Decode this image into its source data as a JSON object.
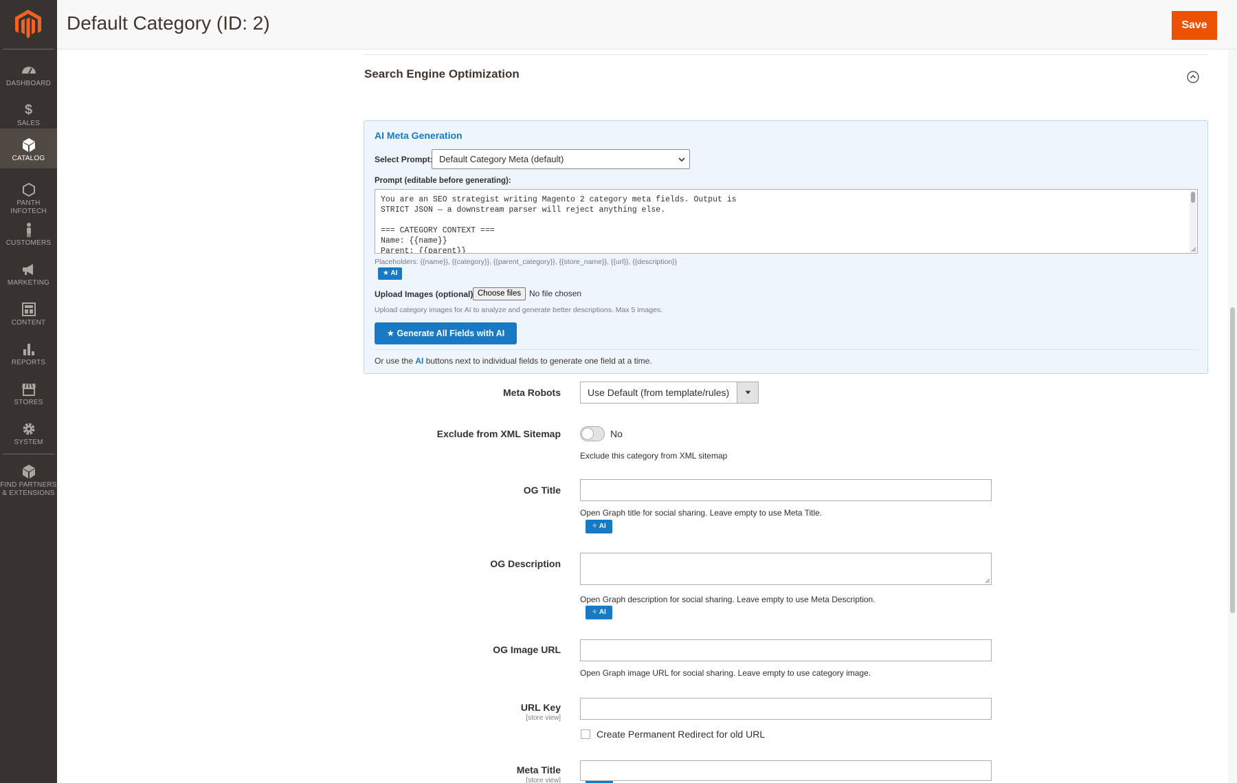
{
  "sidebar": {
    "items": [
      {
        "label": "DASHBOARD",
        "icon": "dashboard-icon"
      },
      {
        "label": "$",
        "icon": "dollar-icon"
      },
      {
        "label": "SALES",
        "icon": "sales-icon"
      },
      {
        "label": "CATALOG",
        "icon": "box-icon"
      },
      {
        "label": "PANTH\nINFOTECH",
        "icon": "hexagon-icon"
      },
      {
        "label": "CUSTOMERS",
        "icon": "person-icon"
      },
      {
        "label": "MARKETING",
        "icon": "megaphone-icon"
      },
      {
        "label": "CONTENT",
        "icon": "layout-icon"
      },
      {
        "label": "REPORTS",
        "icon": "bar-chart-icon"
      },
      {
        "label": "STORES",
        "icon": "store-icon"
      },
      {
        "label": "SYSTEM",
        "icon": "gear-icon"
      },
      {
        "label": "FIND PARTNERS\n& EXTENSIONS",
        "icon": "cube-icon"
      }
    ],
    "active": "CATALOG"
  },
  "header": {
    "title": "Default Category (ID: 2)",
    "save_label": "Save"
  },
  "section": {
    "title": "Search Engine Optimization"
  },
  "ai_panel": {
    "title": "AI Meta Generation",
    "select_prompt_label": "Select Prompt:",
    "select_prompt_value": "Default Category Meta (default)",
    "prompt_label": "Prompt (editable before generating):",
    "prompt_text": "You are an SEO strategist writing Magento 2 category meta fields. Output is\nSTRICT JSON — a downstream parser will reject anything else.\n\n=== CATEGORY CONTEXT ===\nName: {{name}}\nParent: {{parent}}",
    "placeholders": "Placeholders: {{name}}, {{category}}, {{parent_category}}, {{store_name}}, {{url}}, {{description}}",
    "ai_chip": "★ AI",
    "upload_label": "Upload Images (optional):",
    "choose_files": "Choose files",
    "no_file": "No file chosen",
    "upload_hint": "Upload category images for AI to analyze and generate better descriptions. Max 5 images.",
    "generate_all": "★ Generate All Fields with AI",
    "or_use_pre": "Or use the ",
    "or_use_ai": "AI",
    "or_use_post": " buttons next to individual fields to generate one field at a time."
  },
  "form": {
    "meta_robots": {
      "label": "Meta Robots",
      "value": "Use Default (from template/rules)"
    },
    "exclude_sitemap": {
      "label": "Exclude from XML Sitemap",
      "state": "No",
      "note": "Exclude this category from XML sitemap"
    },
    "og_title": {
      "label": "OG Title",
      "note": "Open Graph title for social sharing. Leave empty to use Meta Title.",
      "ai": "✧ AI"
    },
    "og_description": {
      "label": "OG Description",
      "note": "Open Graph description for social sharing. Leave empty to use Meta Description.",
      "ai": "✧ AI"
    },
    "og_image_url": {
      "label": "OG Image URL",
      "note": "Open Graph image URL for social sharing. Leave empty to use category image."
    },
    "url_key": {
      "label": "URL Key",
      "scope": "[store view]",
      "redirect_label": "Create Permanent Redirect for old URL"
    },
    "meta_title": {
      "label": "Meta Title",
      "scope": "[store view]"
    }
  },
  "colors": {
    "accent": "#eb5202",
    "ai_blue": "#1979c3",
    "sidebar_bg": "#373330"
  }
}
